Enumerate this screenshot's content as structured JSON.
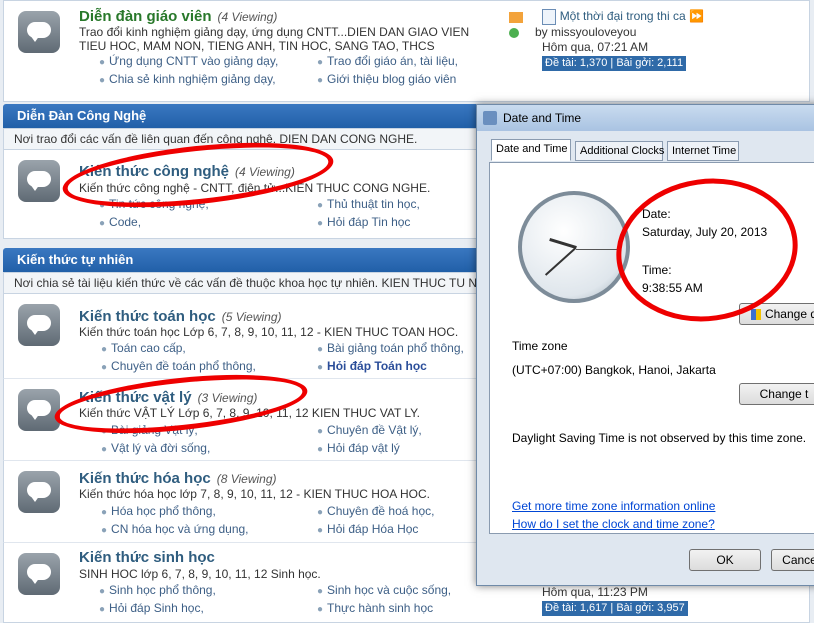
{
  "forum": {
    "top_node": {
      "title": "Diễn đàn giáo viên",
      "viewing": "(4 Viewing)",
      "desc_line1": "Trao đổi kinh nghiệm giảng dạy, ứng dụng CNTT...DIEN DAN GIAO VIEN",
      "desc_line2": "TIEU HOC, MAM NON, TIENG ANH, TIN HOC, SANG TAO, THCS",
      "subs": [
        "Ứng dụng CNTT vào giảng dạy,",
        "Trao đổi giáo án, tài liệu,",
        "Chia sẻ kinh nghiệm giảng dạy,",
        "Giới thiệu blog giáo viên"
      ],
      "last_post": {
        "title": "Một thời đại trong thi ca",
        "by": "by missyouloveyou",
        "time": "Hôm qua, 07:21 AM",
        "stats": "Đề tài: 1,370 | Bài gởi: 2,111"
      }
    },
    "cat_tech": {
      "header": "Diễn Đàn Công Nghệ",
      "desc": "Nơi trao đổi các vấn đề liên quan đến công nghệ. DIEN DAN CONG NGHE.",
      "node": {
        "title": "Kiến thức công nghệ",
        "viewing": "(4 Viewing)",
        "desc": "Kiến thức công nghệ - CNTT, điện tử...KIEN THUC CONG NGHE.",
        "subs": [
          "Tin tức công nghệ,",
          "Thủ thuật tin học,",
          "Code,",
          "Hỏi đáp Tin học"
        ]
      }
    },
    "cat_science": {
      "header": "Kiến thức tự nhiên",
      "desc": "Nơi chia sẻ tài liệu kiến thức về các vấn đề thuộc khoa học tự nhiên. KIEN THUC TU NHIEN.",
      "nodes": [
        {
          "title": "Kiến thức toán học",
          "viewing": "(5 Viewing)",
          "desc": "Kiến thức toán học Lớp 6, 7, 8, 9, 10, 11, 12 - KIEN THUC TOAN HOC.",
          "subs": [
            "Toán cao cấp,",
            "Bài giảng toán phổ thông,",
            "Chuyên đề toán phổ thông,",
            "Hỏi đáp Toán học"
          ]
        },
        {
          "title": "Kiến thức vật lý",
          "viewing": "(3 Viewing)",
          "desc": "Kiến thức VẬT LÝ Lớp 6, 7, 8, 9, 10, 11, 12 KIEN THUC VAT LY.",
          "subs": [
            "Bài giảng Vật lý,",
            "Chuyên đề Vật lý,",
            "Vật lý và đời sống,",
            "Hỏi đáp vật lý"
          ]
        },
        {
          "title": "Kiến thức hóa học",
          "viewing": "(8 Viewing)",
          "desc": "Kiến thức hóa học lớp 7, 8, 9, 10, 11, 12 - KIEN THUC HOA HOC.",
          "subs": [
            "Hóa học phổ thông,",
            "Chuyên đề hoá học,",
            "CN hóa học và ứng dụng,",
            "Hỏi đáp Hóa Học"
          ]
        },
        {
          "title": "Kiến thức sinh học",
          "viewing": "",
          "desc": "SINH HOC lớp 6, 7, 8, 9, 10, 11, 12 Sinh học.",
          "subs": [
            "Sinh học phổ thông,",
            "Sinh học và cuộc sống,",
            "Hỏi đáp Sinh học,",
            "Thực hành sinh học"
          ],
          "last_post": {
            "time": "Hôm qua, 11:23 PM",
            "stats": "Đề tài: 1,617 | Bài gởi: 3,957"
          }
        }
      ]
    }
  },
  "dialog": {
    "title": "Date and Time",
    "tabs": [
      "Date and Time",
      "Additional Clocks",
      "Internet Time"
    ],
    "date_label": "Date:",
    "date_value": "Saturday, July 20, 2013",
    "time_label": "Time:",
    "time_value": "9:38:55 AM",
    "change_datetime_button": "Change d",
    "timezone_label": "Time zone",
    "timezone_value": "(UTC+07:00) Bangkok, Hanoi, Jakarta",
    "change_tz_button": "Change t",
    "dst_note": "Daylight Saving Time is not observed by this time zone.",
    "link1": "Get more time zone information online",
    "link2": "How do I set the clock and time zone?",
    "ok": "OK",
    "cancel": "Cance"
  }
}
